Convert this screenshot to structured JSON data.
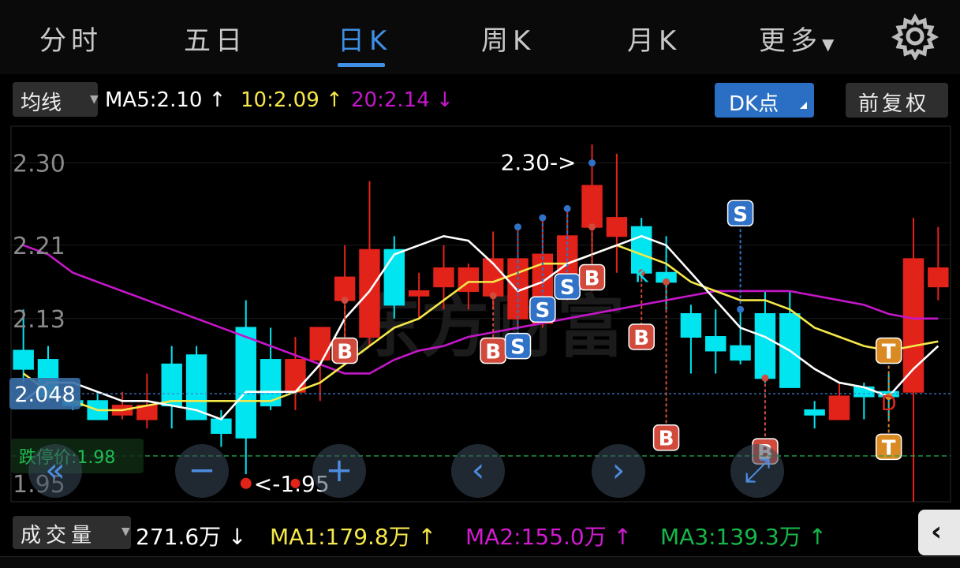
{
  "tabs": [
    "分时",
    "五日",
    "日K",
    "周K",
    "月K",
    "更多"
  ],
  "active_tab": 2,
  "ma_bar": {
    "selector": "均线",
    "ma5": "MA5:2.10 ↑",
    "ma10": "10:2.09 ↑",
    "ma20": "20:2.14 ↓",
    "dk_button": "DK点",
    "adjust_button": "前复权"
  },
  "colors": {
    "up": "#e2231a",
    "down": "#00e5ef",
    "ma5": "#ffffff",
    "ma10": "#f5e84a",
    "ma20": "#c417c8",
    "accent": "#3f8fe6"
  },
  "chart_data": {
    "type": "candlestick",
    "y_ticks": [
      "2.30",
      "2.21",
      "2.13",
      "1.95"
    ],
    "ylim": [
      1.93,
      2.34
    ],
    "current_price": "2.048",
    "limit_down": "跌停价:1.98",
    "high_label": "2.30->",
    "low_label": "<-1.95",
    "candles": [
      {
        "o": 2.095,
        "h": 2.14,
        "l": 2.06,
        "c": 2.075,
        "ma5": 2.04,
        "ma10": 2.07,
        "ma20": 2.21
      },
      {
        "o": 2.085,
        "h": 2.1,
        "l": 2.04,
        "c": 2.045,
        "ma5": 2.06,
        "ma10": 2.05,
        "ma20": 2.2
      },
      {
        "o": 2.04,
        "h": 2.05,
        "l": 2.03,
        "c": 2.035,
        "ma5": 2.06,
        "ma10": 2.04,
        "ma20": 2.18
      },
      {
        "o": 2.04,
        "h": 2.05,
        "l": 2.025,
        "c": 2.02,
        "ma5": 2.05,
        "ma10": 2.03,
        "ma20": 2.17
      },
      {
        "o": 2.025,
        "h": 2.05,
        "l": 2.02,
        "c": 2.035,
        "ma5": 2.04,
        "ma10": 2.03,
        "ma20": 2.16
      },
      {
        "o": 2.02,
        "h": 2.07,
        "l": 2.01,
        "c": 2.035,
        "ma5": 2.04,
        "ma10": 2.035,
        "ma20": 2.15
      },
      {
        "o": 2.08,
        "h": 2.1,
        "l": 2.01,
        "c": 2.035,
        "ma5": 2.035,
        "ma10": 2.04,
        "ma20": 2.14
      },
      {
        "o": 2.09,
        "h": 2.1,
        "l": 2.02,
        "c": 2.02,
        "ma5": 2.03,
        "ma10": 2.04,
        "ma20": 2.13
      },
      {
        "o": 2.02,
        "h": 2.03,
        "l": 1.99,
        "c": 2.005,
        "ma5": 2.02,
        "ma10": 2.04,
        "ma20": 2.12
      },
      {
        "o": 2.12,
        "h": 2.15,
        "l": 1.96,
        "c": 2.0,
        "ma5": 2.05,
        "ma10": 2.04,
        "ma20": 2.11
      },
      {
        "o": 2.085,
        "h": 2.12,
        "l": 2.03,
        "c": 2.035,
        "ma5": 2.05,
        "ma10": 2.04,
        "ma20": 2.1
      },
      {
        "o": 2.05,
        "h": 2.11,
        "l": 2.03,
        "c": 2.085,
        "ma5": 2.05,
        "ma10": 2.05,
        "ma20": 2.09
      },
      {
        "o": 2.085,
        "h": 2.12,
        "l": 2.04,
        "c": 2.12,
        "ma5": 2.08,
        "ma10": 2.06,
        "ma20": 2.08
      },
      {
        "o": 2.15,
        "h": 2.21,
        "l": 2.09,
        "c": 2.175,
        "ma5": 2.13,
        "ma10": 2.08,
        "ma20": 2.07
      },
      {
        "o": 2.11,
        "h": 2.28,
        "l": 2.1,
        "c": 2.205,
        "ma5": 2.16,
        "ma10": 2.1,
        "ma20": 2.07
      },
      {
        "o": 2.205,
        "h": 2.22,
        "l": 2.13,
        "c": 2.145,
        "ma5": 2.2,
        "ma10": 2.12,
        "ma20": 2.085
      },
      {
        "o": 2.155,
        "h": 2.18,
        "l": 2.13,
        "c": 2.16,
        "ma5": 2.21,
        "ma10": 2.13,
        "ma20": 2.095
      },
      {
        "o": 2.165,
        "h": 2.21,
        "l": 2.14,
        "c": 2.185,
        "ma5": 2.22,
        "ma10": 2.15,
        "ma20": 2.1
      },
      {
        "o": 2.16,
        "h": 2.19,
        "l": 2.14,
        "c": 2.185,
        "ma5": 2.215,
        "ma10": 2.17,
        "ma20": 2.11
      },
      {
        "o": 2.155,
        "h": 2.225,
        "l": 2.14,
        "c": 2.195,
        "ma5": 2.19,
        "ma10": 2.17,
        "ma20": 2.115
      },
      {
        "o": 2.13,
        "h": 2.23,
        "l": 2.12,
        "c": 2.195,
        "ma5": 2.16,
        "ma10": 2.18,
        "ma20": 2.12
      },
      {
        "o": 2.125,
        "h": 2.24,
        "l": 2.12,
        "c": 2.2,
        "ma5": 2.17,
        "ma10": 2.19,
        "ma20": 2.125
      },
      {
        "o": 2.175,
        "h": 2.25,
        "l": 2.15,
        "c": 2.22,
        "ma5": 2.19,
        "ma10": 2.19,
        "ma20": 2.13
      },
      {
        "o": 2.23,
        "h": 2.32,
        "l": 2.16,
        "c": 2.275,
        "ma5": 2.2,
        "ma10": 2.2,
        "ma20": 2.135
      },
      {
        "o": 2.22,
        "h": 2.31,
        "l": 2.18,
        "c": 2.24,
        "ma5": 2.21,
        "ma10": 2.21,
        "ma20": 2.14
      },
      {
        "o": 2.23,
        "h": 2.24,
        "l": 2.17,
        "c": 2.18,
        "ma5": 2.22,
        "ma10": 2.2,
        "ma20": 2.145
      },
      {
        "o": 2.18,
        "h": 2.22,
        "l": 2.14,
        "c": 2.17,
        "ma5": 2.21,
        "ma10": 2.19,
        "ma20": 2.15
      },
      {
        "o": 2.135,
        "h": 2.145,
        "l": 2.07,
        "c": 2.11,
        "ma5": 2.18,
        "ma10": 2.17,
        "ma20": 2.155
      },
      {
        "o": 2.11,
        "h": 2.14,
        "l": 2.07,
        "c": 2.095,
        "ma5": 2.15,
        "ma10": 2.16,
        "ma20": 2.16
      },
      {
        "o": 2.1,
        "h": 2.14,
        "l": 2.08,
        "c": 2.085,
        "ma5": 2.12,
        "ma10": 2.15,
        "ma20": 2.16
      },
      {
        "o": 2.135,
        "h": 2.16,
        "l": 2.06,
        "c": 2.065,
        "ma5": 2.11,
        "ma10": 2.15,
        "ma20": 2.16
      },
      {
        "o": 2.135,
        "h": 2.16,
        "l": 2.06,
        "c": 2.055,
        "ma5": 2.095,
        "ma10": 2.14,
        "ma20": 2.16
      },
      {
        "o": 2.03,
        "h": 2.04,
        "l": 2.01,
        "c": 2.025,
        "ma5": 2.075,
        "ma10": 2.12,
        "ma20": 2.155
      },
      {
        "o": 2.02,
        "h": 2.06,
        "l": 2.02,
        "c": 2.045,
        "ma5": 2.06,
        "ma10": 2.11,
        "ma20": 2.15
      },
      {
        "o": 2.055,
        "h": 2.06,
        "l": 2.02,
        "c": 2.045,
        "ma5": 2.055,
        "ma10": 2.1,
        "ma20": 2.145
      },
      {
        "o": 2.05,
        "h": 2.07,
        "l": 2.02,
        "c": 2.045,
        "ma5": 2.045,
        "ma10": 2.095,
        "ma20": 2.135
      },
      {
        "o": 2.05,
        "h": 2.24,
        "l": 1.93,
        "c": 2.195,
        "ma5": 2.075,
        "ma10": 2.1,
        "ma20": 2.13
      },
      {
        "o": 2.165,
        "h": 2.23,
        "l": 2.15,
        "c": 2.185,
        "ma5": 2.1,
        "ma10": 2.105,
        "ma20": 2.13
      }
    ],
    "signals": [
      {
        "i": 13,
        "label": "B",
        "y": 2.095,
        "color": "#d24a3c"
      },
      {
        "i": 19,
        "label": "B",
        "y": 2.095,
        "color": "#d24a3c"
      },
      {
        "i": 20,
        "label": "S",
        "y": 2.1,
        "color": "#2f72c8"
      },
      {
        "i": 21,
        "label": "S",
        "y": 2.14,
        "color": "#2f72c8"
      },
      {
        "i": 22,
        "label": "S",
        "y": 2.165,
        "color": "#2f72c8"
      },
      {
        "i": 23,
        "label": "B",
        "y": 2.175,
        "color": "#d24a3c"
      },
      {
        "i": 25,
        "label": "B",
        "y": 2.11,
        "color": "#d24a3c"
      },
      {
        "i": 26,
        "label": "B",
        "y": 2.0,
        "color": "#d24a3c"
      },
      {
        "i": 29,
        "label": "S",
        "y": 2.245,
        "color": "#2f72c8"
      },
      {
        "i": 30,
        "label": "B",
        "y": 1.985,
        "color": "#d24a3c"
      },
      {
        "i": 35,
        "label": "T",
        "y": 2.095,
        "color": "#d98a22"
      },
      {
        "i": 35,
        "label": "T",
        "y": 1.99,
        "color": "#d98a22"
      }
    ],
    "letter_marks": [
      {
        "i": 12,
        "label": "D",
        "y": 2.1,
        "color": "#d8281e"
      },
      {
        "i": 25,
        "label": "K",
        "y": 2.17,
        "color": "#00e5ef"
      },
      {
        "i": 35,
        "label": "D",
        "y": 2.03,
        "color": "#d8281e"
      }
    ]
  },
  "volume_bar": {
    "selector": "成交量",
    "vol": "271.6万 ↓",
    "ma1": "MA1:179.8万 ↑",
    "ma2": "MA2:155.0万 ↑",
    "ma3": "MA3:139.3万 ↑"
  }
}
